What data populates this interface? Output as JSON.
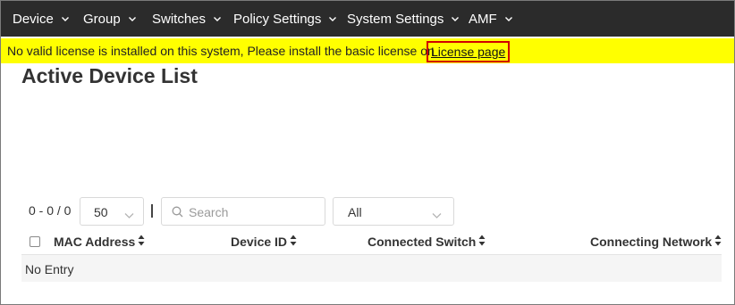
{
  "nav": {
    "items": [
      {
        "label": "Device"
      },
      {
        "label": "Group"
      },
      {
        "label": "Switches"
      },
      {
        "label": "Policy Settings"
      },
      {
        "label": "System Settings"
      },
      {
        "label": "AMF"
      }
    ]
  },
  "banner": {
    "message": "No valid license is installed on this system, Please install the basic license on",
    "link_label": "License page",
    "background": "#ffff00",
    "highlight_color": "#d00000"
  },
  "page": {
    "title": "Active Device List"
  },
  "toolbar": {
    "range": "0 - 0 / 0",
    "page_size": "50",
    "search_placeholder": "Search",
    "search_value": "",
    "filter": "All"
  },
  "table": {
    "columns": [
      {
        "label": "MAC Address"
      },
      {
        "label": "Device ID"
      },
      {
        "label": "Connected Switch"
      },
      {
        "label": "Connecting Network"
      }
    ],
    "empty_text": "No Entry"
  },
  "colors": {
    "navbar": "#2b2b2b",
    "nav_text": "#ffffff"
  }
}
